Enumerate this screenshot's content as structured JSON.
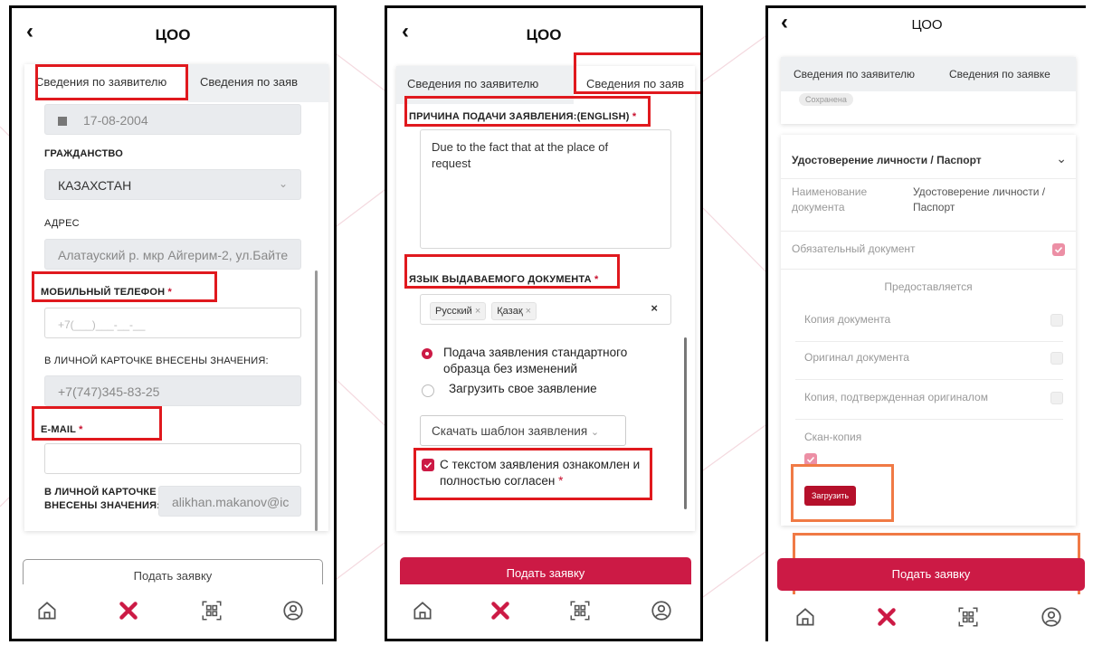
{
  "common": {
    "back_icon": "‹",
    "app_title": "ЦОО",
    "tab_applicant": "Сведения по заявителю",
    "tab_application": "Сведения по заяв",
    "submit_label": "Подать заявку"
  },
  "phone1": {
    "birthdate": "17-08-2004",
    "citizenship_label": "ГРАЖДАНСТВО",
    "citizenship_value": "КАЗАХСТАН",
    "address_label": "АДРЕС",
    "address_value": "Алатауский р. мкр Айгерим-2, ул.Байте",
    "mobile_label": "МОБИЛЬНЫЙ ТЕЛЕФОН",
    "mobile_placeholder": "+7(___)___-__-__",
    "card_values_label": "В ЛИЧНОЙ КАРТОЧКЕ ВНЕСЕНЫ ЗНАЧЕНИЯ:",
    "card_phone_value": "+7(747)345-83-25",
    "email_label": "E-MAIL",
    "card_values_label2_line1": "В ЛИЧНОЙ КАРТОЧКЕ",
    "card_values_label2_line2": "ВНЕСЕНЫ ЗНАЧЕНИЯ:",
    "card_email_value": "alikhan.makanov@ic",
    "required_mark": "*"
  },
  "phone2": {
    "reason_label": "ПРИЧИНА ПОДАЧИ ЗАЯВЛЕНИЯ:(ENGLISH)",
    "reason_line1": "Due to the fact that at the place of",
    "reason_line2": "request",
    "language_label": "ЯЗЫК ВЫДАВАЕМОГО ДОКУМЕНТА",
    "chips": [
      "Русский",
      "Қазақ"
    ],
    "chip_remove": "×",
    "clear_all": "×",
    "radio1_line1": "Подача заявления стандартного",
    "radio1_line2": "образца без изменений",
    "radio2": "Загрузить свое заявление",
    "download_template": "Скачать шаблон заявления",
    "agree_line1": "С текстом заявления ознакомлен и",
    "agree_line2": "полностью согласен",
    "required_mark": "*"
  },
  "phone3": {
    "tab_applicant": "Сведения по заявителю",
    "tab_application": "Сведения по заявке",
    "saved_badge": "Сохранена",
    "section_title": "Удостоверение личности / Паспорт",
    "doc_name_label_line1": "Наименование",
    "doc_name_label_line2": "документа",
    "doc_name_value_line1": "Удостоверение личности /",
    "doc_name_value_line2": "Паспорт",
    "mandatory_label": "Обязательный документ",
    "provided_label": "Предоставляется",
    "copy_label": "Копия документа",
    "original_label": "Оригинал документа",
    "certified_copy_label": "Копия, подтвержденная оригиналом",
    "scan_label": "Скан-копия",
    "upload_label": "Загрузить"
  },
  "colors": {
    "accent": "#cc1a45",
    "highlight_red": "#e0191e",
    "highlight_orange": "#f07a45"
  }
}
